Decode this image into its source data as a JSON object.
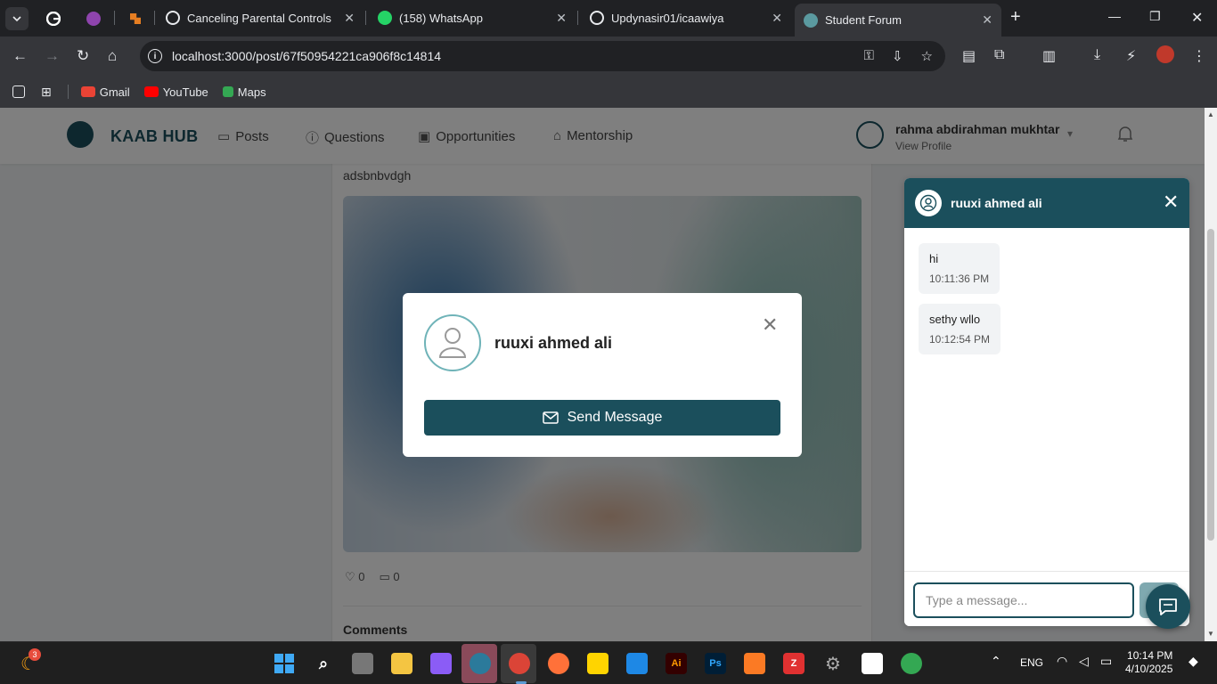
{
  "browser": {
    "tabs": [
      {
        "title": "Canceling Parental Controls",
        "active": false
      },
      {
        "title": "(158) WhatsApp",
        "active": false
      },
      {
        "title": "Updynasir01/icaawiya",
        "active": false
      },
      {
        "title": "Student Forum",
        "active": true
      }
    ],
    "url": "localhost:3000/post/67f50954221ca906f8c14814",
    "bookmarks": [
      "Gmail",
      "YouTube",
      "Maps"
    ]
  },
  "site": {
    "brand": "KAAB HUB",
    "nav": [
      "Posts",
      "Questions",
      "Opportunities",
      "Mentorship"
    ],
    "user": {
      "name": "rahma abdirahman mukhtar",
      "sub": "View Profile"
    }
  },
  "post": {
    "body": "adsbnbvdgh",
    "likes": "0",
    "comments": "0",
    "comments_title": "Comments"
  },
  "modal": {
    "name": "ruuxi ahmed ali",
    "send_label": "Send Message"
  },
  "chat": {
    "name": "ruuxi ahmed ali",
    "messages": [
      {
        "text": "hi",
        "time": "10:11:36 PM"
      },
      {
        "text": "sethy wllo",
        "time": "10:12:54 PM"
      }
    ],
    "input_placeholder": "Type a message..."
  },
  "taskbar": {
    "notification_count": "3",
    "lang": "ENG",
    "time": "10:14 PM",
    "date": "4/10/2025"
  },
  "colors": {
    "primary": "#1b4f5c",
    "chrome_dark": "#202124",
    "chrome_mid": "#35363a"
  }
}
